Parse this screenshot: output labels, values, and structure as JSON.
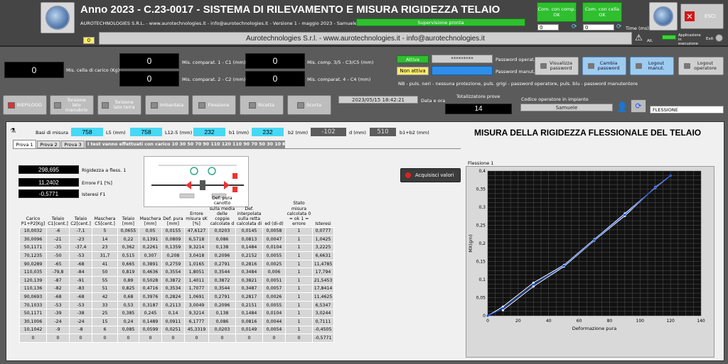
{
  "header": {
    "title": "Anno 2023 - C.23-0017 - SISTEMA DI RILEVAMENTO E MISURA RIGIDEZZA TELAIO",
    "subtitle": "AUROTECHNOLOGIES S.R.L. - www.aurotechnologies.it - info@aurotechnologies.it - Versione 1 - maggio 2023 - Samuele Bettin",
    "supervisione": "Supervisione pronta",
    "banner": "Aurotechnologies S.r.l. - www.aurotechnologies.it - info@aurotechnologies.it",
    "counter": "0",
    "com_comp": "Com. con comp. OK",
    "com_cella": "Com. con cella OK",
    "com_comp_val": "0",
    "com_cella_val": "0",
    "time_label": "Time (ms)",
    "all_label": "All.",
    "app_label": "Applicazione in esecuzione",
    "exit_label": "Exit",
    "esci": "ESCI"
  },
  "readings": {
    "cella": "0",
    "cella_label": "Mis. cella di carico (Kg)",
    "c1": "0",
    "c1_label": "Mis. comparat. 1 - C1 (mm)",
    "c2": "0",
    "c2_label": "Mis. comparat. 2 - C2 (mm)",
    "c35": "0",
    "c35_label": "Mis. comp. 3/5 - C3/C5 (mm)",
    "c4": "0",
    "c4_label": "Mis. comparat. 4 - C4 (mm)"
  },
  "password": {
    "attiva": "Attiva",
    "non_attiva": "Non attiva",
    "oper_value": "*********",
    "oper_label": "Password operat.",
    "manut_label": "Password manut.",
    "note": "NB - puls. neri - nessuna protezione, puls. grigi - password operatore, puls. blu - password manutentore",
    "visualizza": "Visualizza password",
    "cambia": "Cambia password",
    "logout_manut": "Logout manut.",
    "logout_oper": "Logout operatore"
  },
  "nav": {
    "riepilogo": "RIEPILOGO",
    "torsione_manubrio": "Torsione lato manubrio",
    "torsione_terra": "Torsione lato terra",
    "imbardata": "Imbardata",
    "flessione": "Flessione",
    "ricetta": "Ricetta",
    "scorta": "Scorta",
    "datetime": "2023/05/15 18:42:21",
    "datetime_label": "Data e ora",
    "totalizzatore_label": "Totalizzatore prove",
    "totalizzatore": "14",
    "operatore_label": "Codice operatore in impianto",
    "operatore": "Samuele",
    "mode": "FLESSIONE"
  },
  "params": {
    "basi_label": "Basi di misura",
    "l": "758",
    "l_label": "L5 (mm)",
    "l12": "758",
    "l12_label": "L12-5 (mm)",
    "b1": "232",
    "b1_label": "b1 (mm)",
    "b2": "232",
    "b2_label": "b2 (mm)",
    "d": "-102",
    "d_label": "d (mm)",
    "b12": "510",
    "b12_label": "b1+b2 (mm)",
    "panel_title": "MISURA DELLA RIGIDEZZA FLESSIONALE DEL TELAIO"
  },
  "tabs": {
    "t1": "Prova 1",
    "t2": "Prova 2",
    "t3": "Prova 3",
    "info": "I test vanno effettuati con carico 10 30 50 70 90 110 120 110 90 70 50 30 10 Kg"
  },
  "results": {
    "rig": "298,695",
    "rig_label": "Rigidezza a fless. 1",
    "err": "11,2402",
    "err_label": "Errore F1 [%]",
    "ist": "-0,5771",
    "ist_label": "Isteresi F1",
    "acquisisci": "Acquisisci valori"
  },
  "table": {
    "headers": [
      "Carico P1+P2[Kg]",
      "Telaio C1[cent.]",
      "Telaio C2[cent.]",
      "Maschera C5[cent.]",
      "Telaio [mm]",
      "Maschera [mm]",
      "Def. pura [mm]",
      "Errore misura sK [%]",
      "Def. pura canotto sulla media delle coppie calcolate d",
      "Def. interpolata sulla retta calcolata di",
      "ed (di-d)",
      "Stato misura calcolata 0 = ok 1 = errore",
      "Isteresi"
    ],
    "rows": [
      [
        "10,0032",
        "-6",
        "-7,1",
        "5",
        "0,0655",
        "0,05",
        "0,0155",
        "47,6127",
        "0,0203",
        "0,0145",
        "0,0058",
        "1",
        "0,0777"
      ],
      [
        "30,0096",
        "-21",
        "-23",
        "14",
        "0,22",
        "0,1391",
        "0,0809",
        "6,5718",
        "0,086",
        "0,0813",
        "0,0047",
        "1",
        "1,0425"
      ],
      [
        "50,1171",
        "-35",
        "-37,4",
        "23",
        "0,362",
        "0,2261",
        "0,1359",
        "9,3214",
        "0,138",
        "0,1484",
        "0,0104",
        "1",
        "3,2225"
      ],
      [
        "70,1235",
        "-50",
        "-53",
        "31,7",
        "0,515",
        "0,307",
        "0,208",
        "3,0418",
        "0,2096",
        "0,2152",
        "0,0055",
        "1",
        "6,6631"
      ],
      [
        "90,0289",
        "-65",
        "-68",
        "41",
        "0,665",
        "0,3891",
        "0,2759",
        "1,0165",
        "0,2791",
        "0,2816",
        "0,0025",
        "1",
        "11,4785"
      ],
      [
        "110,035",
        "-79,8",
        "-84",
        "50",
        "0,819",
        "0,4636",
        "0,3554",
        "1,8051",
        "0,3544",
        "0,3484",
        "0,006",
        "1",
        "17,794"
      ],
      [
        "120,139",
        "-87",
        "-91",
        "55",
        "0,89",
        "0,5028",
        "0,3872",
        "1,4011",
        "0,3872",
        "0,3821",
        "0,0051",
        "1",
        "21,5453"
      ],
      [
        "110,136",
        "-82",
        "-83",
        "51",
        "0,825",
        "0,4716",
        "0,3534",
        "1,7077",
        "0,3544",
        "0,3487",
        "0,0057",
        "1",
        "17,8414"
      ],
      [
        "90,0693",
        "-68",
        "-68",
        "42",
        "0,68",
        "0,3976",
        "0,2824",
        "1,0691",
        "0,2791",
        "0,2817",
        "0,0026",
        "1",
        "11,4625"
      ],
      [
        "70,1033",
        "-53",
        "-53",
        "33",
        "0,53",
        "0,3187",
        "0,2113",
        "3,0049",
        "0,2096",
        "0,2151",
        "0,0055",
        "1",
        "6,5347"
      ],
      [
        "50,1171",
        "-39",
        "-38",
        "25",
        "0,385",
        "0,245",
        "0,14",
        "9,3214",
        "0,138",
        "0,1484",
        "0,0104",
        "1",
        "3,0244"
      ],
      [
        "30,1006",
        "-24",
        "-24",
        "15",
        "0,24",
        "0,1489",
        "0,0911",
        "6,1777",
        "0,086",
        "0,0816",
        "0,0044",
        "1",
        "0,7111"
      ],
      [
        "10,1042",
        "-9",
        "-8",
        "6",
        "0,085",
        "0,0599",
        "0,0251",
        "45,3319",
        "0,0203",
        "0,0149",
        "0,0054",
        "1",
        "-0,4505"
      ],
      [
        "0",
        "0",
        "0",
        "0",
        "0",
        "0",
        "0",
        "0",
        "0",
        "0",
        "0",
        "0",
        "-0,5771"
      ]
    ]
  },
  "chart_data": {
    "type": "scatter",
    "title": "Flessione 1",
    "xlabel": "Deformazione pura",
    "ylabel": "MX(gm)",
    "xlim": [
      0,
      140
    ],
    "ylim": [
      0,
      0.4
    ],
    "xticks": [
      0,
      20,
      40,
      60,
      80,
      100,
      120,
      140
    ],
    "yticks": [
      0,
      0.05,
      0.1,
      0.15,
      0.2,
      0.25,
      0.3,
      0.35,
      0.4
    ],
    "ytick_labels": [
      "0",
      "0,05",
      "0,1",
      "0,15",
      "0,2",
      "0,25",
      "0,3",
      "0,35",
      "0,4"
    ],
    "grid": true,
    "series": [
      {
        "points": [
          [
            10,
            0.0155
          ],
          [
            30,
            0.0809
          ],
          [
            50,
            0.1359
          ],
          [
            70,
            0.208
          ],
          [
            90,
            0.2759
          ],
          [
            110,
            0.3554
          ],
          [
            120,
            0.3872
          ],
          [
            110,
            0.3534
          ],
          [
            90,
            0.2824
          ],
          [
            70,
            0.2113
          ],
          [
            50,
            0.14
          ],
          [
            30,
            0.0911
          ],
          [
            10,
            0.0251
          ],
          [
            0,
            0
          ]
        ],
        "color": "#ffffff"
      },
      {
        "points": [
          [
            0,
            0
          ],
          [
            10,
            0.0203
          ],
          [
            30,
            0.086
          ],
          [
            50,
            0.138
          ],
          [
            70,
            0.2096
          ],
          [
            90,
            0.2791
          ],
          [
            110,
            0.3544
          ],
          [
            120,
            0.3872
          ]
        ],
        "color": "#1a5cff"
      }
    ]
  }
}
